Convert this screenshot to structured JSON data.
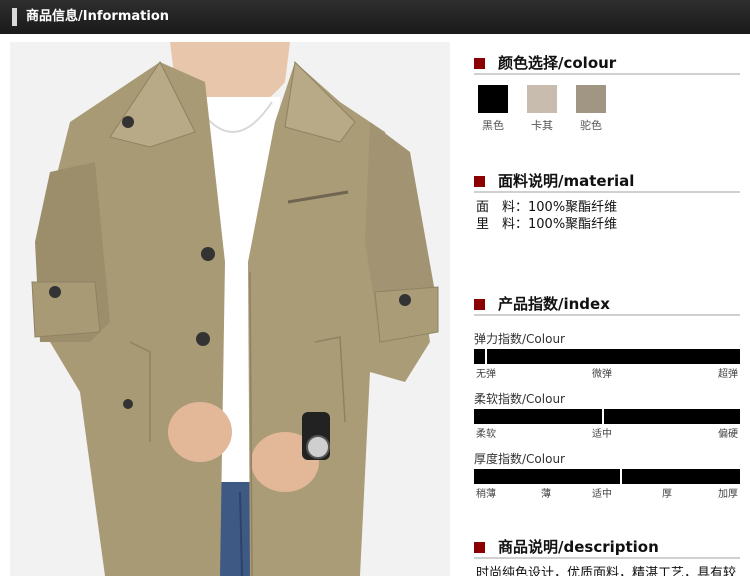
{
  "header": {
    "title": "商品信息/Information"
  },
  "colour": {
    "title": "颜色选择/colour",
    "swatches": [
      {
        "name": "黑色",
        "color": "#000000"
      },
      {
        "name": "卡其",
        "color": "#c8bcae"
      },
      {
        "name": "驼色",
        "color": "#a19683"
      }
    ]
  },
  "material": {
    "title": "面料说明/material",
    "lines": [
      "面　料：100%聚酯纤维",
      "里　料：100%聚酯纤维"
    ]
  },
  "index": {
    "title": "产品指数/index",
    "rows": [
      {
        "label": "弹力指数/Colour",
        "scale": [
          "无弹",
          "微弹",
          "超弹"
        ],
        "level": 0.04
      },
      {
        "label": "柔软指数/Colour",
        "scale": [
          "柔软",
          "适中",
          "偏硬"
        ],
        "level": 0.48
      },
      {
        "label": "厚度指数/Colour",
        "scale": [
          "稍薄",
          "薄",
          "适中",
          "厚",
          "加厚"
        ],
        "level": 0.55
      }
    ]
  },
  "description": {
    "title": "商品说明/description",
    "text": "时尚纯色设计，优质面料，精湛工艺，具有较"
  },
  "colors": {
    "accent": "#8b0000",
    "header_bg": "#222222",
    "coat": "#a99a76"
  }
}
